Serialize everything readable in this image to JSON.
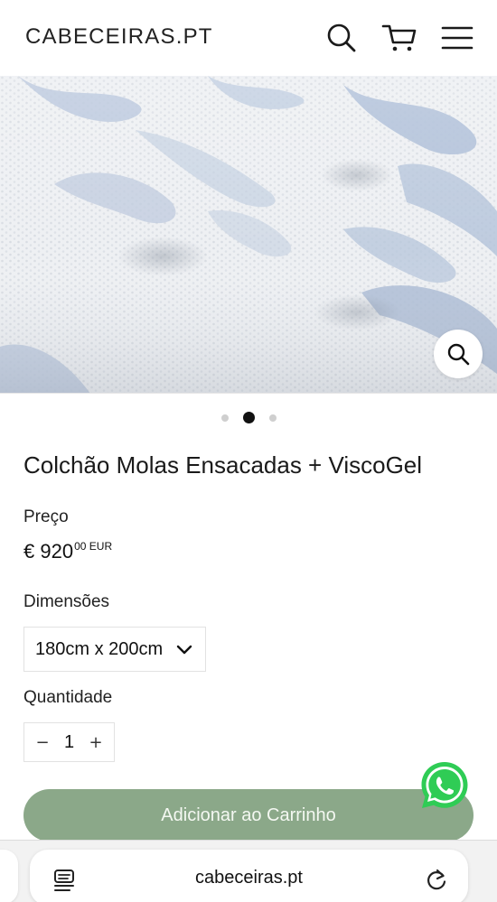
{
  "header": {
    "logo": "CABECEIRAS.PT",
    "icons": [
      "search-icon",
      "cart-icon",
      "menu-icon"
    ]
  },
  "gallery": {
    "image": "mattress-fabric-photo",
    "slide_count": 3,
    "active_slide": 2,
    "zoom_icon": "zoom-icon"
  },
  "product": {
    "title": "Colchão Molas Ensacadas + ViscoGel",
    "price_label": "Preço",
    "price_currency_symbol": "€",
    "price_integer": "920",
    "price_cents": "00 EUR",
    "dimensions_label": "Dimensões",
    "dimensions_selected": "180cm x 200cm",
    "quantity_label": "Quantidade",
    "quantity_value": "1",
    "quantity_minus": "−",
    "quantity_plus": "+",
    "add_to_cart": "Adicionar ao Carrinho"
  },
  "floating": {
    "whatsapp_icon": "whatsapp-icon"
  },
  "browser": {
    "url": "cabeceiras.pt",
    "icons": [
      "reader-icon",
      "reload-icon"
    ]
  },
  "colors": {
    "cta_background": "#8ba889",
    "whatsapp_green": "#2fcc55",
    "fabric_blue": "#a9bbd6"
  }
}
